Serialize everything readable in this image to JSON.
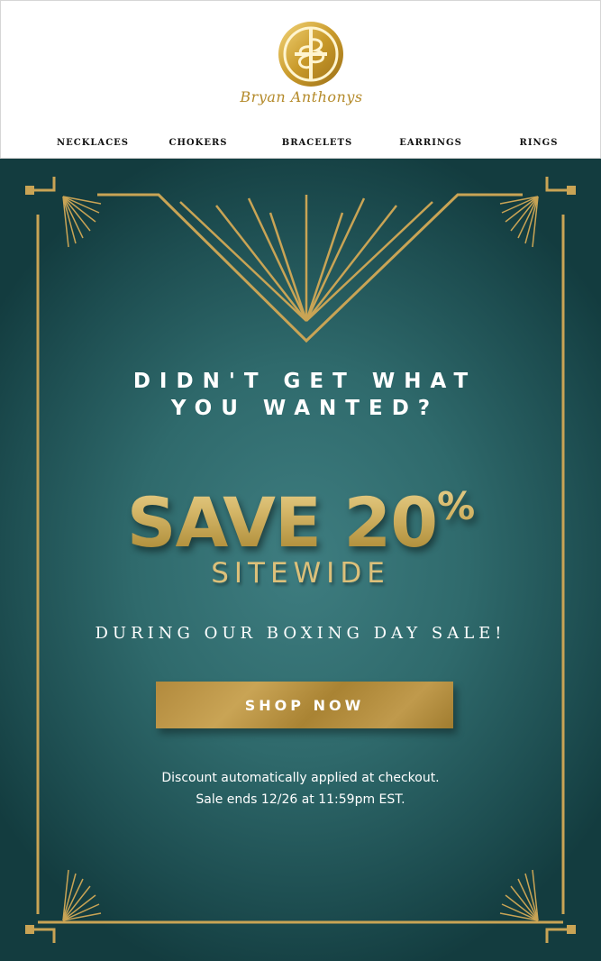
{
  "brand": {
    "name": "Bryan Anthonys"
  },
  "nav": {
    "items": [
      {
        "label": "NECKLACES"
      },
      {
        "label": "CHOKERS"
      },
      {
        "label": "BRACELETS"
      },
      {
        "label": "EARRINGS"
      },
      {
        "label": "RINGS"
      }
    ]
  },
  "hero": {
    "headline_line1": "DIDN'T GET WHAT",
    "headline_line2": "YOU WANTED?",
    "offer_main": "SAVE 20",
    "offer_percent": "%",
    "offer_scope": "SITEWIDE",
    "event_line": "DURING OUR BOXING DAY SALE!",
    "cta_label": "SHOP NOW",
    "fine_print_line1": "Discount automatically applied at checkout.",
    "fine_print_line2": "Sale ends 12/26 at 11:59pm EST."
  },
  "colors": {
    "gold": "#c9a455",
    "teal": "#2f6a6c",
    "teal_dark": "#133c3f"
  }
}
